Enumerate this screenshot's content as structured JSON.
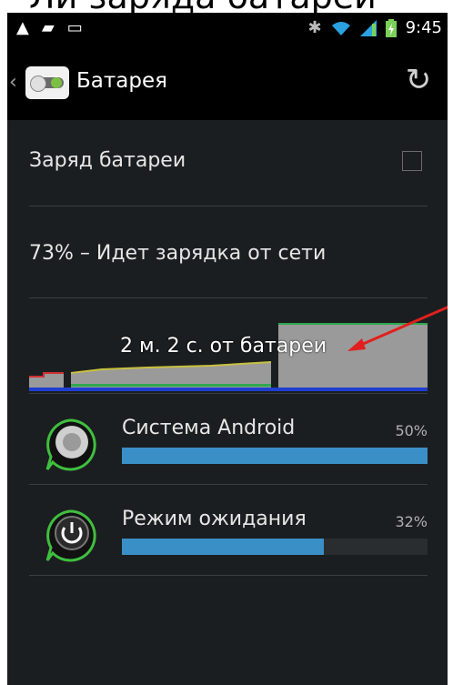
{
  "caption": "Ли заряда батареи",
  "status": {
    "time": "9:45",
    "left_icons": [
      "alert-icon",
      "chat-icon",
      "image-icon"
    ],
    "right_icons": [
      "bluetooth-icon",
      "wifi-icon",
      "signal-icon",
      "battery-charging-icon"
    ]
  },
  "header": {
    "title": "Батарея"
  },
  "settings": {
    "battery_percent_label": "Заряд батареи",
    "battery_percent_checked": false
  },
  "status_line": "73% – Идет зарядка от сети",
  "graph": {
    "label": "2 м. 2 с. от батареи"
  },
  "apps": [
    {
      "name": "Система Android",
      "percent_label": "50%",
      "percent": 100
    },
    {
      "name": "Режим ожидания",
      "percent_label": "32%",
      "percent": 66
    }
  ],
  "colors": {
    "accent": "#3a8fc7",
    "background": "#1b1e20",
    "graph_fill": "#9a9a9a",
    "graph_green": "#2fa84f",
    "graph_blue": "#1f3fd0",
    "graph_yellow": "#c8c040",
    "graph_red": "#d03030",
    "arrow": "#e0201e"
  }
}
